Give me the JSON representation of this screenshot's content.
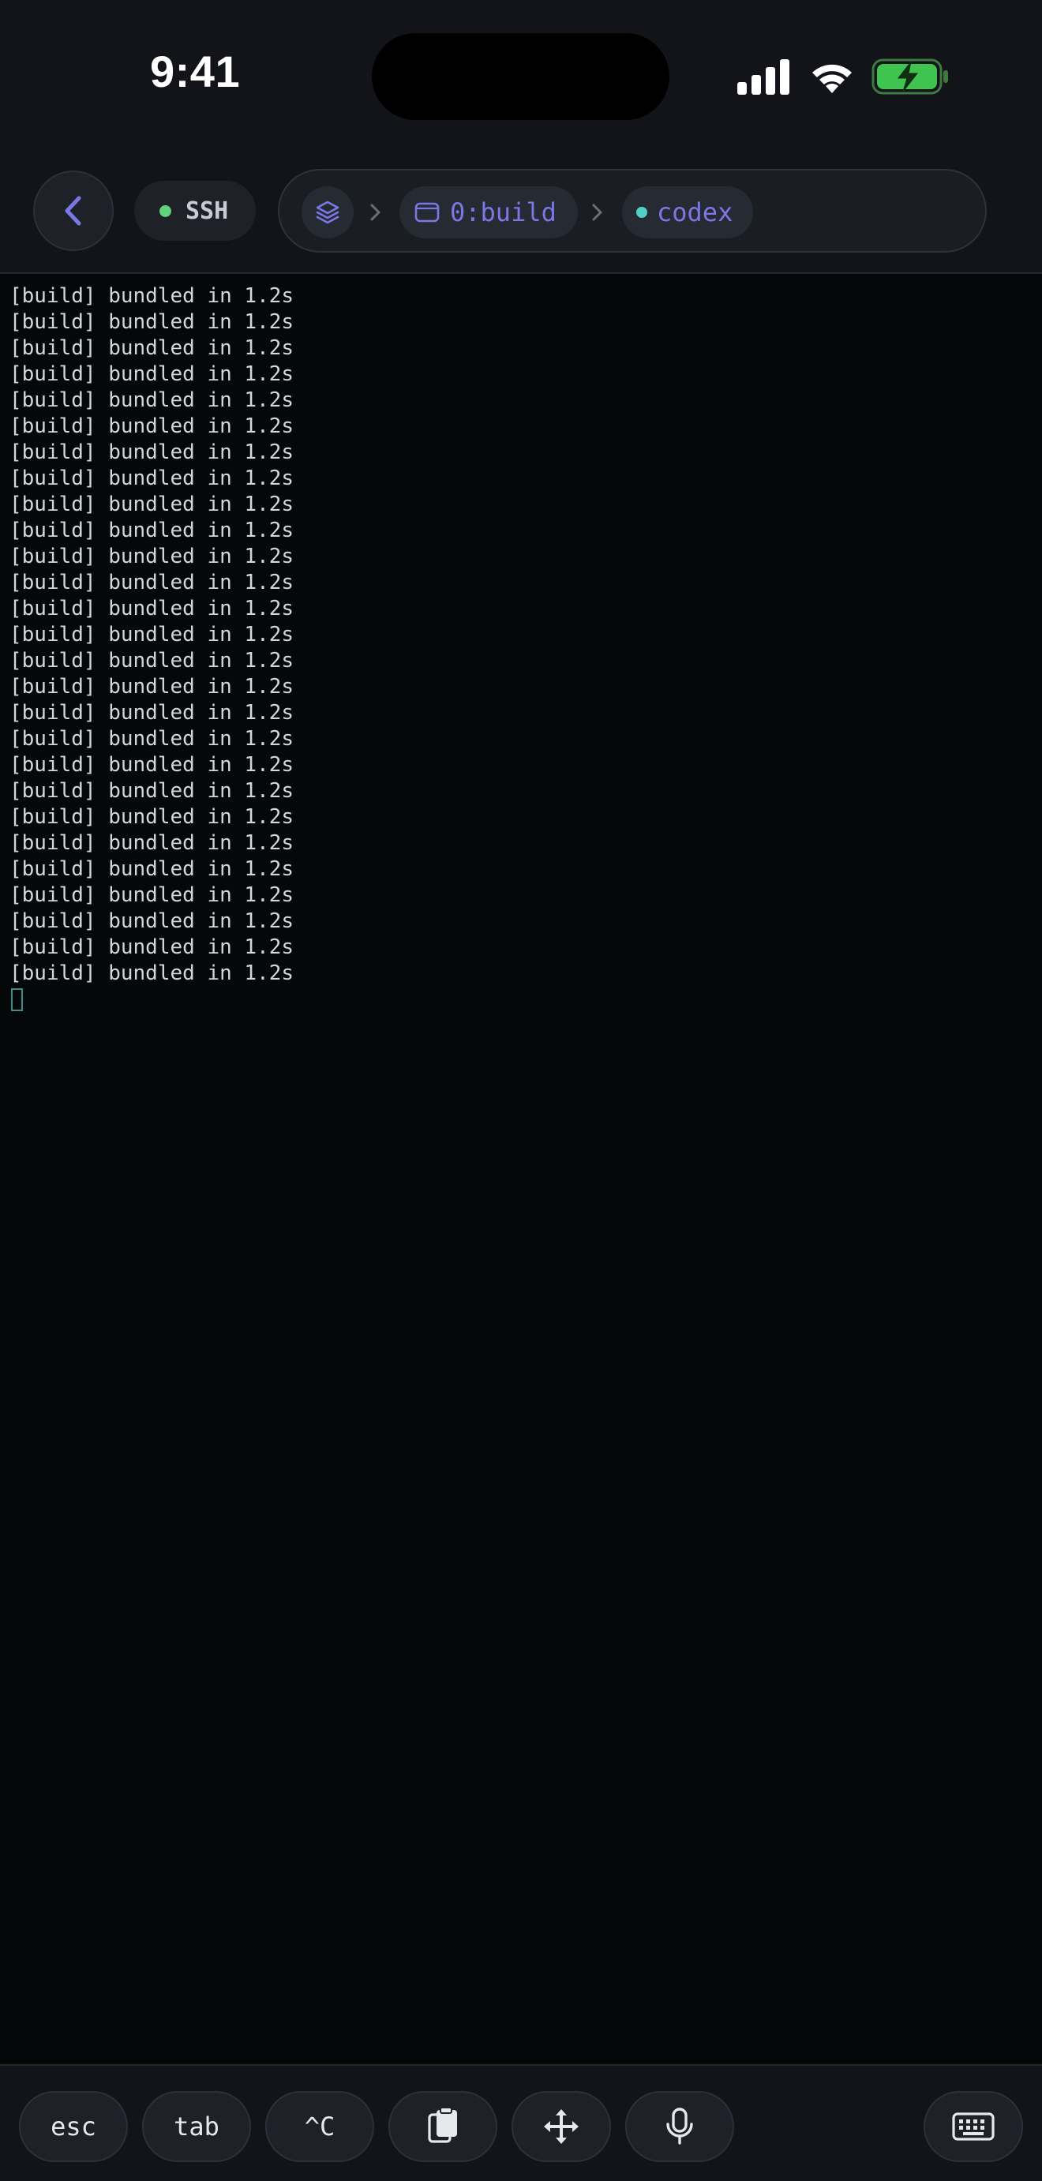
{
  "status_bar": {
    "time": "9:41",
    "icons": [
      "cellular-signal-icon",
      "wifi-icon",
      "battery-charging-icon"
    ]
  },
  "header": {
    "connection": {
      "label": "SSH",
      "status_color": "#61d17a"
    },
    "breadcrumb": {
      "session_icon": "layers-icon",
      "window": "0:build",
      "pane": "codex",
      "accent_color": "#7b78e6",
      "pane_dot_color": "#4fd1c5"
    }
  },
  "terminal": {
    "lines": [
      "[build] bundled in 1.2s",
      "[build] bundled in 1.2s",
      "[build] bundled in 1.2s",
      "[build] bundled in 1.2s",
      "[build] bundled in 1.2s",
      "[build] bundled in 1.2s",
      "[build] bundled in 1.2s",
      "[build] bundled in 1.2s",
      "[build] bundled in 1.2s",
      "[build] bundled in 1.2s",
      "[build] bundled in 1.2s",
      "[build] bundled in 1.2s",
      "[build] bundled in 1.2s",
      "[build] bundled in 1.2s",
      "[build] bundled in 1.2s",
      "[build] bundled in 1.2s",
      "[build] bundled in 1.2s",
      "[build] bundled in 1.2s",
      "[build] bundled in 1.2s",
      "[build] bundled in 1.2s",
      "[build] bundled in 1.2s",
      "[build] bundled in 1.2s",
      "[build] bundled in 1.2s",
      "[build] bundled in 1.2s",
      "[build] bundled in 1.2s",
      "[build] bundled in 1.2s",
      "[build] bundled in 1.2s"
    ],
    "cursor_color": "#3e8c86"
  },
  "keybar": {
    "esc": "esc",
    "tab": "tab",
    "ctrl_c": "^C",
    "paste_icon": "clipboard-icon",
    "move_icon": "move-arrows-icon",
    "mic_icon": "microphone-icon",
    "keyboard_icon": "keyboard-icon"
  }
}
